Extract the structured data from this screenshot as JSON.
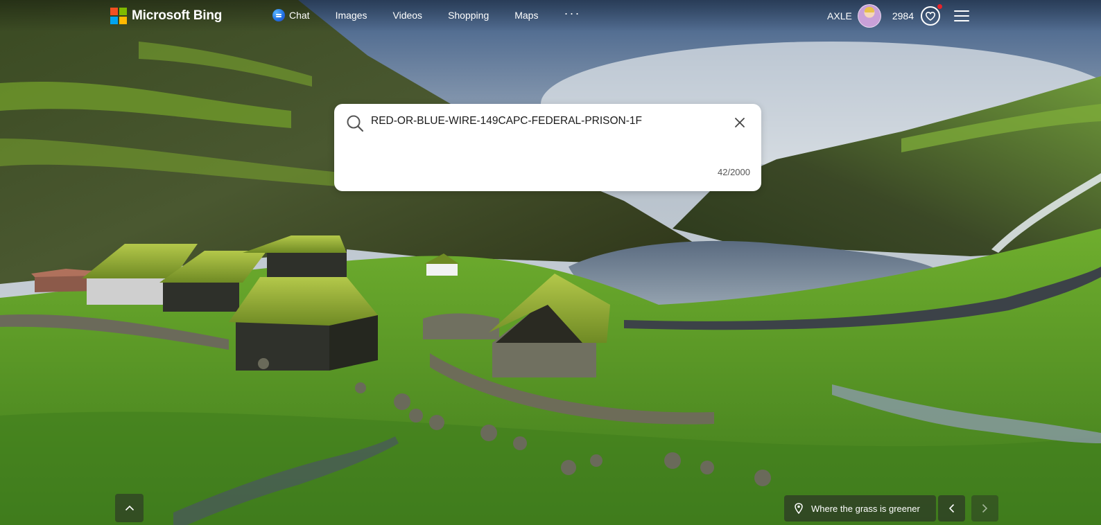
{
  "brand": {
    "name": "Microsoft Bing",
    "logo_colors": [
      "#f25022",
      "#7fba00",
      "#00a4ef",
      "#ffb900"
    ]
  },
  "nav": {
    "items": [
      {
        "label": "Chat",
        "icon": "chat-icon"
      },
      {
        "label": "Images"
      },
      {
        "label": "Videos"
      },
      {
        "label": "Shopping"
      },
      {
        "label": "Maps"
      }
    ],
    "more_label": "···"
  },
  "account": {
    "username": "AXLE",
    "points": "2984",
    "rewards_icon": "heart-icon",
    "menu_icon": "hamburger-icon"
  },
  "search": {
    "query": "RED-OR-BLUE-WIRE-149CAPC-FEDERAL-PRISON-1F",
    "char_count": "42/2000",
    "icon": "search-icon",
    "clear_icon": "close-icon"
  },
  "footer": {
    "image_caption": "Where the grass is greener",
    "location_icon": "location-pin-icon",
    "scroll_up_icon": "chevron-up-icon",
    "prev_icon": "chevron-left-icon",
    "next_icon": "chevron-right-icon"
  }
}
